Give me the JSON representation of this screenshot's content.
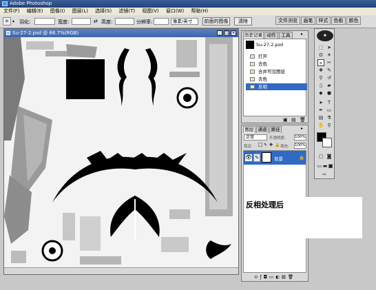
{
  "app": {
    "title": "Adobe Photoshop"
  },
  "menu": [
    "文件(F)",
    "编辑(E)",
    "图像(I)",
    "图层(L)",
    "选择(S)",
    "滤镜(T)",
    "视图(V)",
    "窗口(W)",
    "帮助(H)"
  ],
  "options": {
    "feather_label": "羽化:",
    "width_label": "宽度:",
    "height_label": "高度:",
    "resolution_label": "分辨率:",
    "resolution_unit": "像素/英寸",
    "front_image_button": "前面的图像",
    "clear_button": "清除"
  },
  "well_tabs": [
    "文件浏览",
    "画笔",
    "样式",
    "色板",
    "颜色"
  ],
  "document": {
    "title": "Su-27-2.psd @ 66.7%(RGB)"
  },
  "history": {
    "tabs": [
      "历史记录",
      "动作",
      "工具"
    ],
    "snapshot": "Su-27-2.psd",
    "items": [
      "打开",
      "去色",
      "合并可见图层",
      "去色",
      "反相"
    ],
    "selected_index": 4
  },
  "layers": {
    "tabs": [
      "图层",
      "通道",
      "路径"
    ],
    "blend_mode": "正常",
    "opacity_label": "不透明度:",
    "opacity": "100%",
    "lock_label": "锁定:",
    "fill_label": "填充:",
    "fill": "100%",
    "layer_name": "背景"
  },
  "caption": "反相处理后"
}
